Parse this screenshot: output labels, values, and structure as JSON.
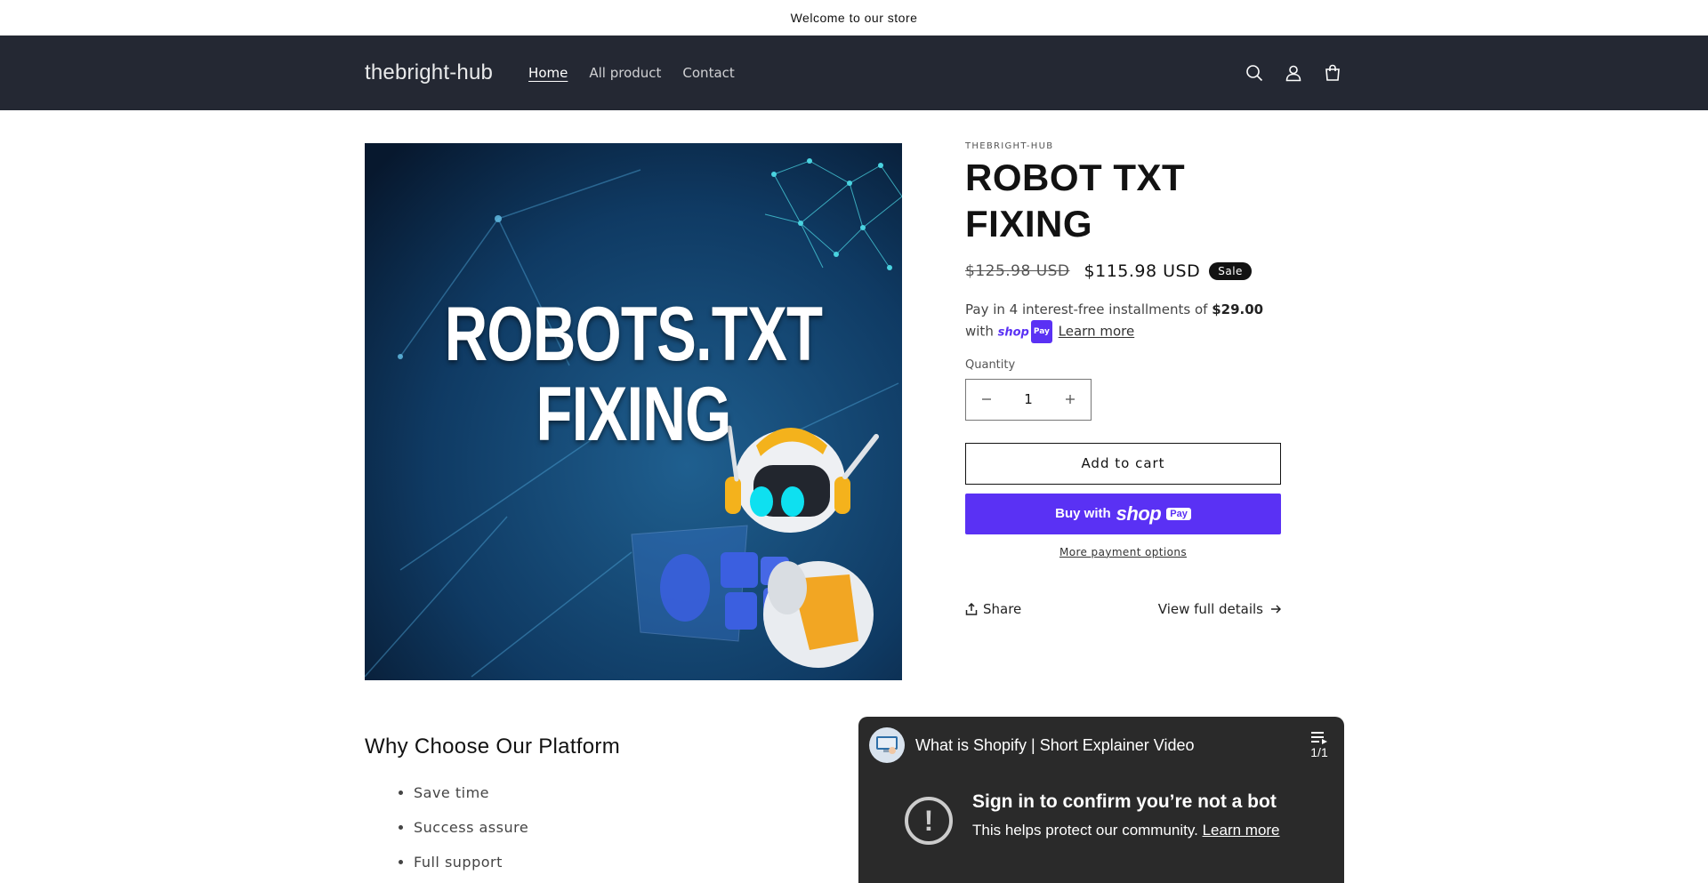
{
  "announcement": "Welcome to our store",
  "header": {
    "logo": "thebright-hub",
    "nav": [
      "Home",
      "All product",
      "Contact"
    ],
    "icons": [
      "search-icon",
      "account-icon",
      "cart-icon"
    ]
  },
  "product": {
    "image_title_line1": "ROBOTS.TXT",
    "image_title_line2": "FIXING",
    "vendor": "THEBRIGHT-HUB",
    "title_line1": "ROBOT TXT",
    "title_line2": "FIXING",
    "price_regular": "$125.98 USD",
    "price_sale": "$115.98 USD",
    "badge": "Sale",
    "installments_text": "Pay in 4 interest-free installments of",
    "installments_amount": "$29.00",
    "installments_with": "with",
    "shop_word": "shop",
    "shop_pay_pill": "Pay",
    "learn_more": "Learn more",
    "quantity_label": "Quantity",
    "quantity_value": "1",
    "add_to_cart": "Add to cart",
    "buy_with": "Buy with",
    "more_payment": "More payment options",
    "share": "Share",
    "view_details": "View full details"
  },
  "why": {
    "heading": "Why Choose Our Platform",
    "items": [
      "Save time",
      "Success assure",
      "Full support"
    ]
  },
  "video": {
    "title": "What is Shopify | Short Explainer Video",
    "playlist_count": "1/1",
    "alert_title": "Sign in to confirm you’re not a bot",
    "alert_text": "This helps protect our community.",
    "alert_link": "Learn more"
  },
  "colors": {
    "header_bg": "#242833",
    "shop_pay": "#5a31f4",
    "badge_bg": "#121212",
    "video_bg": "#2a2a2a"
  }
}
